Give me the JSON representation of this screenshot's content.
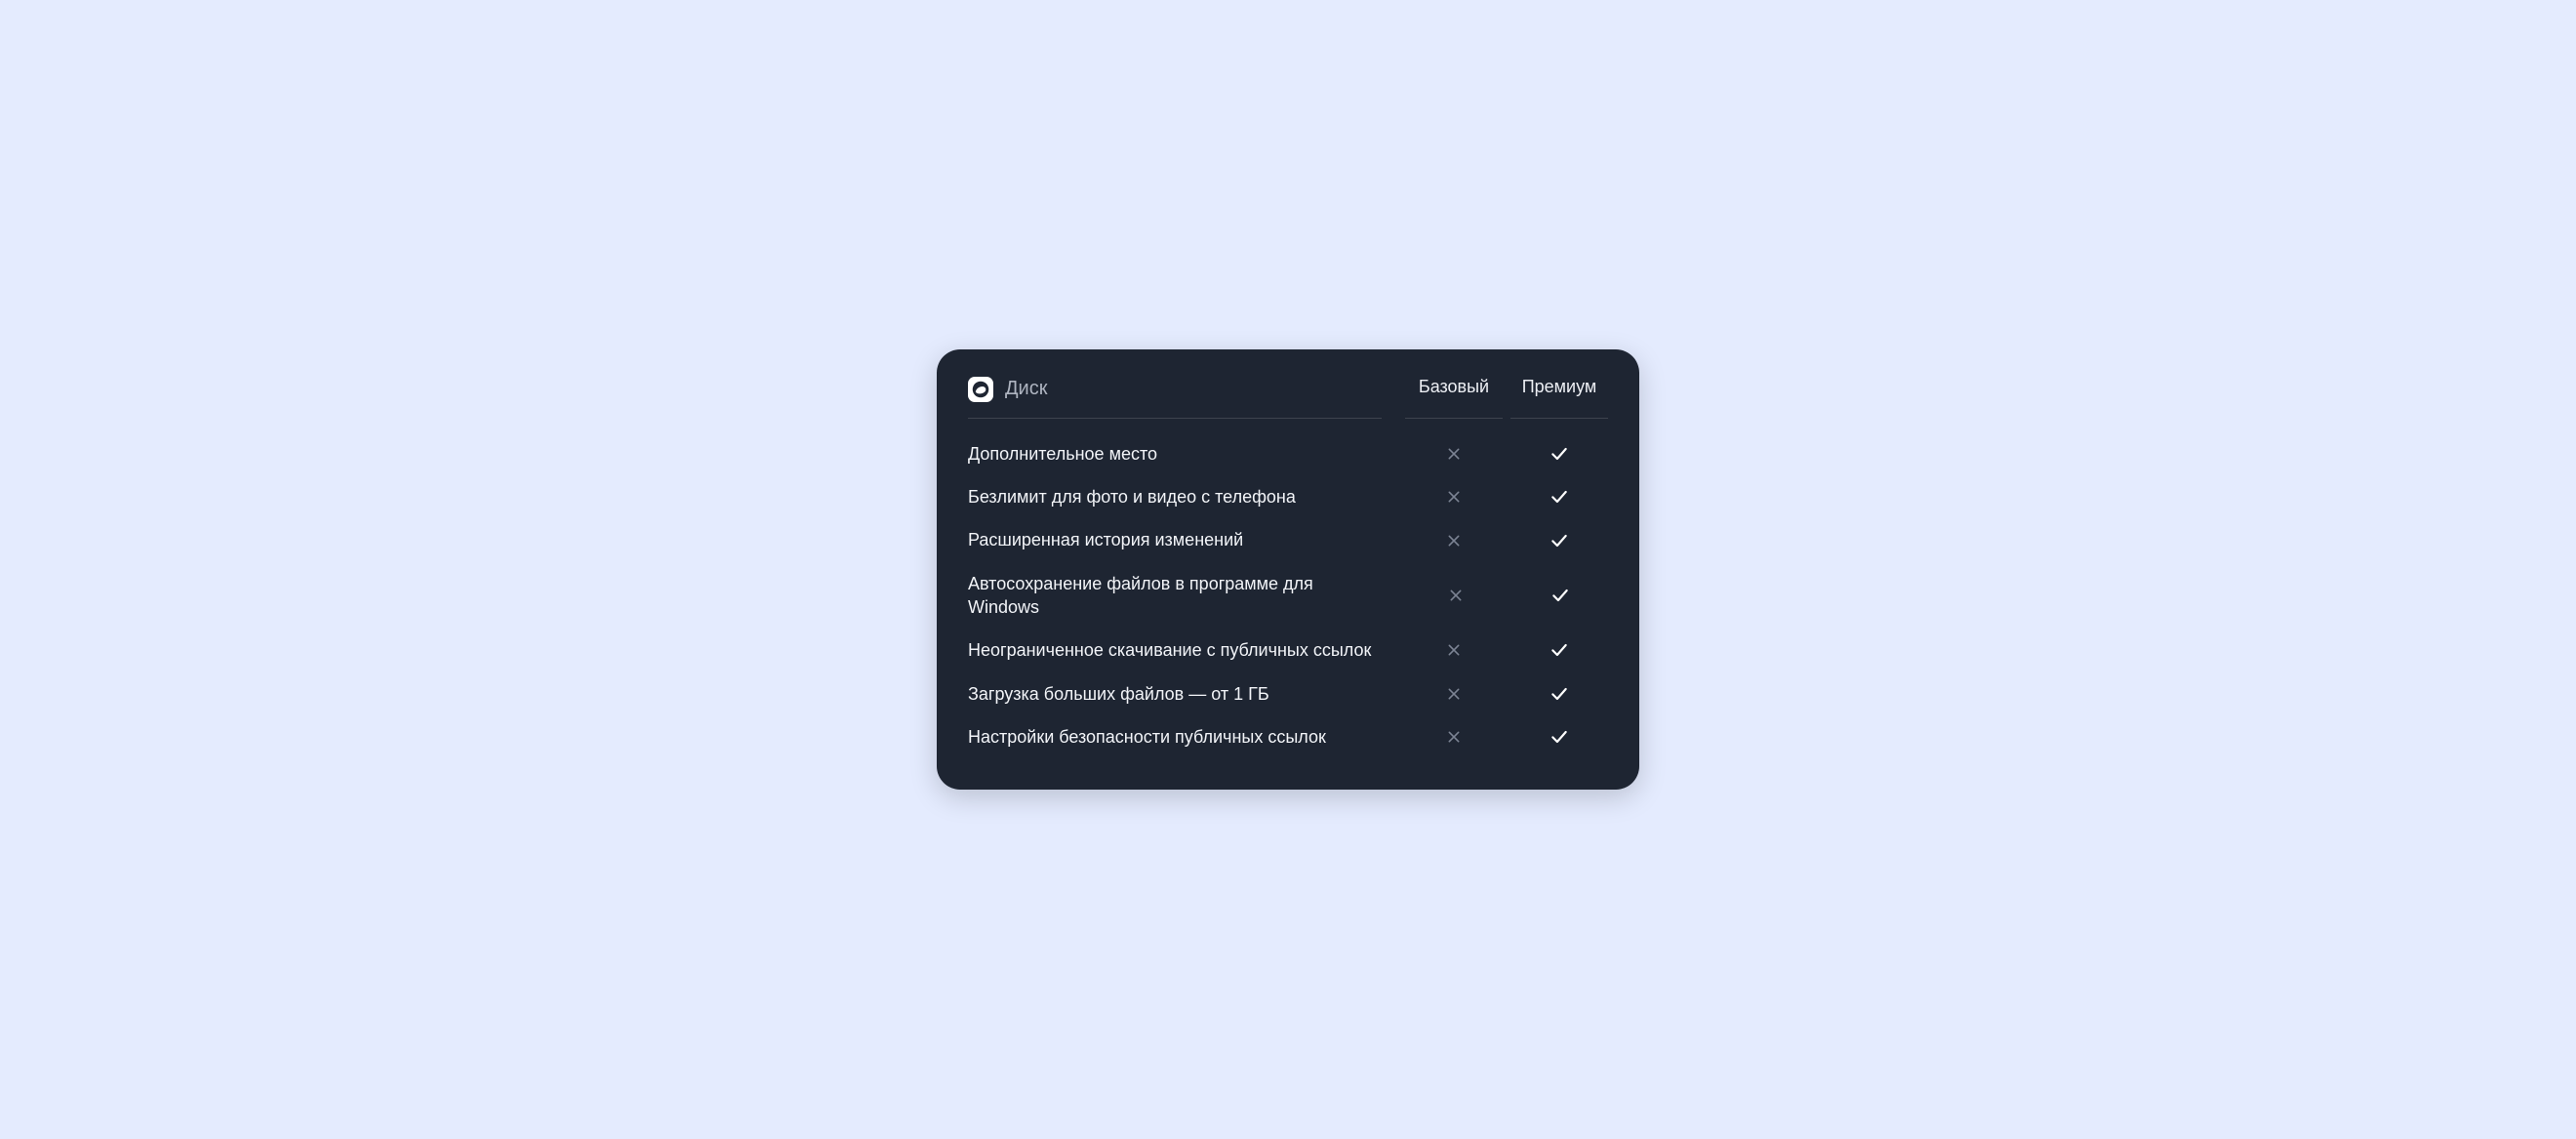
{
  "card": {
    "title": "Диск",
    "columns": {
      "basic": "Базовый",
      "premium": "Премиум"
    },
    "features": [
      {
        "label": "Дополнительное место",
        "basic": false,
        "premium": true
      },
      {
        "label": "Безлимит для фото и видео с телефона",
        "basic": false,
        "premium": true
      },
      {
        "label": "Расширенная история изменений",
        "basic": false,
        "premium": true
      },
      {
        "label": "Автосохранение файлов в программе для Windows",
        "basic": false,
        "premium": true
      },
      {
        "label": "Неограниченное скачивание с публичных ссылок",
        "basic": false,
        "premium": true
      },
      {
        "label": "Загрузка больших файлов — от 1 ГБ",
        "basic": false,
        "premium": true
      },
      {
        "label": "Настройки безопасности публичных ссылок",
        "basic": false,
        "premium": true
      }
    ]
  }
}
